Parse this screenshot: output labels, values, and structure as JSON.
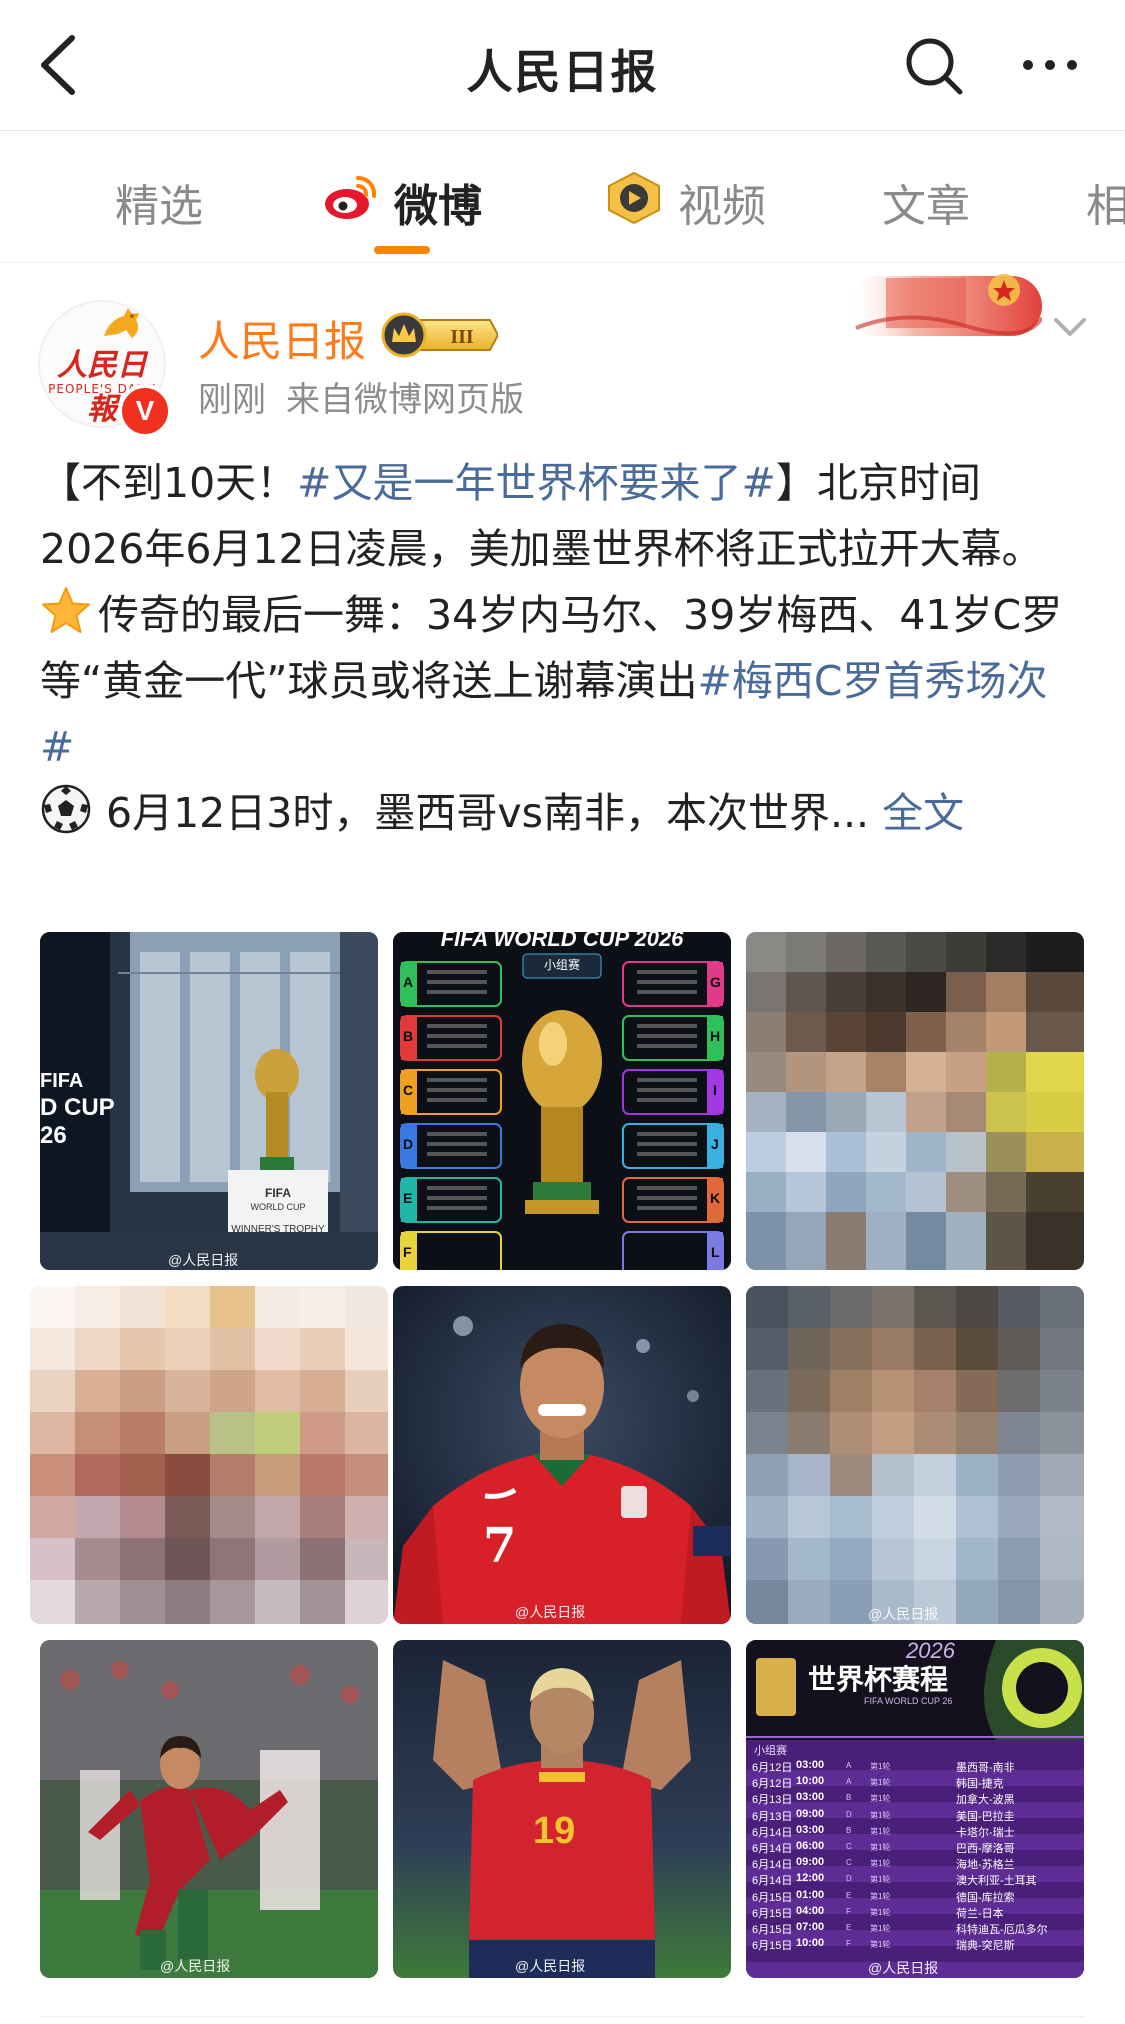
{
  "header": {
    "title": "人民日报"
  },
  "tabs": [
    {
      "label": "精选"
    },
    {
      "label": "微博"
    },
    {
      "label": "视频"
    },
    {
      "label": "文章"
    },
    {
      "label": "相"
    }
  ],
  "post": {
    "author": "人民日报",
    "avatar_cn": "人民日報",
    "avatar_en": "PEOPLE'S DAILY",
    "verified_mark": "V",
    "level_badge": "III",
    "time": "刚刚",
    "source": "来自微博网页版",
    "text": {
      "p1_a": "【不到10天！",
      "p1_tag": "#又是一年世界杯要来了#",
      "p1_b": "】北京时间2026年6月12日凌晨，美加墨世界杯将正式拉开大幕。",
      "p2_a": "传奇的最后一舞：34岁内马尔、39岁梅西、41岁C罗等“黄金一代”球员或将送上谢幕演出",
      "p2_tag": "#梅西C罗首秀场次#",
      "p3_a": "6月12日3时，墨西哥vs南非，本次世界...",
      "p3_more": "全文"
    }
  },
  "images": {
    "wm": "@人民日报",
    "img1": {
      "fifa_a": "FIFA",
      "cup": "D CUP",
      "year": "26",
      "plinth1": "FIFA",
      "plinth2": "WORLD CUP",
      "plinth3": "WINNER'S TROPHY"
    },
    "img2": {
      "title": "FIFA WORLD CUP 2026",
      "subtitle": "小组赛",
      "groups_left": [
        "A",
        "B",
        "C",
        "D",
        "E",
        "F"
      ],
      "groups_right": [
        "G",
        "H",
        "I",
        "J",
        "K",
        "L"
      ]
    },
    "img5": {
      "number": "7"
    },
    "img8": {
      "number": "19"
    },
    "img9": {
      "year": "2026",
      "title": "世界杯赛程",
      "sub": "FIFA WORLD CUP 26",
      "brand": "FIFA",
      "stage": "小组赛",
      "rows": [
        {
          "date": "6月12日",
          "time": "03:00",
          "group": "A",
          "round": "第1轮",
          "match": "墨西哥-南非"
        },
        {
          "date": "6月12日",
          "time": "10:00",
          "group": "A",
          "round": "第1轮",
          "match": "韩国-捷克"
        },
        {
          "date": "6月13日",
          "time": "03:00",
          "group": "B",
          "round": "第1轮",
          "match": "加拿大-波黑"
        },
        {
          "date": "6月13日",
          "time": "09:00",
          "group": "D",
          "round": "第1轮",
          "match": "美国-巴拉圭"
        },
        {
          "date": "6月14日",
          "time": "03:00",
          "group": "B",
          "round": "第1轮",
          "match": "卡塔尔-瑞士"
        },
        {
          "date": "6月14日",
          "time": "06:00",
          "group": "C",
          "round": "第1轮",
          "match": "巴西-摩洛哥"
        },
        {
          "date": "6月14日",
          "time": "09:00",
          "group": "C",
          "round": "第1轮",
          "match": "海地-苏格兰"
        },
        {
          "date": "6月14日",
          "time": "12:00",
          "group": "D",
          "round": "第1轮",
          "match": "澳大利亚-土耳其"
        },
        {
          "date": "6月15日",
          "time": "01:00",
          "group": "E",
          "round": "第1轮",
          "match": "德国-库拉索"
        },
        {
          "date": "6月15日",
          "time": "04:00",
          "group": "F",
          "round": "第1轮",
          "match": "荷兰-日本"
        },
        {
          "date": "6月15日",
          "time": "07:00",
          "group": "E",
          "round": "第1轮",
          "match": "科特迪瓦-厄瓜多尔"
        },
        {
          "date": "6月15日",
          "time": "10:00",
          "group": "F",
          "round": "第1轮",
          "match": "瑞典-突尼斯"
        }
      ]
    }
  }
}
